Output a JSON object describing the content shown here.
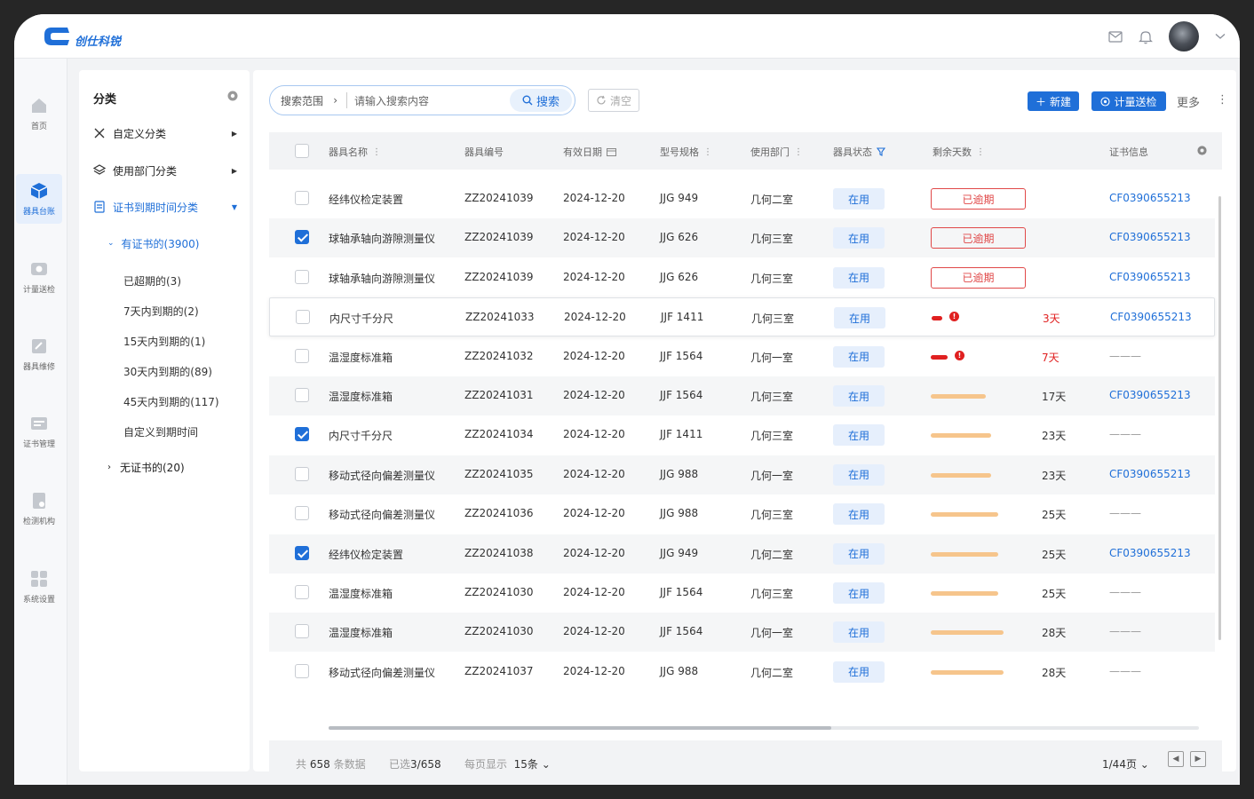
{
  "app": {
    "brand": "创仕科锐"
  },
  "nav": [
    {
      "label": "首页",
      "icon": "home-icon"
    },
    {
      "label": "器具台账",
      "icon": "cube-icon",
      "active": true
    },
    {
      "label": "计量送检",
      "icon": "meter-icon"
    },
    {
      "label": "器具维修",
      "icon": "repair-icon"
    },
    {
      "label": "证书管理",
      "icon": "certificate-icon"
    },
    {
      "label": "检测机构",
      "icon": "lab-icon"
    },
    {
      "label": "系统设置",
      "icon": "settings-grid-icon"
    }
  ],
  "category": {
    "title": "分类",
    "items": [
      {
        "label": "自定义分类"
      },
      {
        "label": "使用部门分类"
      },
      {
        "label": "证书到期时间分类"
      }
    ],
    "group_with_cert": "有证书的(3900)",
    "sub_items": [
      "已超期的(3)",
      "7天内到期的(2)",
      "15天内到期的(1)",
      "30天内到期的(89)",
      "45天内到期的(117)",
      "自定义到期时间"
    ],
    "group_no_cert": "无证书的(20)"
  },
  "toolbar": {
    "search_scope": "搜索范围",
    "search_placeholder": "请输入搜索内容",
    "search_label": "搜索",
    "clear_label": "清空",
    "new_label": "新建",
    "send_label": "计量送检",
    "more_label": "更多"
  },
  "columns": [
    "器具名称",
    "器具编号",
    "有效日期",
    "型号规格",
    "使用部门",
    "器具状态",
    "剩余天数",
    "证书信息"
  ],
  "rows": [
    {
      "checked": false,
      "name": "经纬仪检定装置",
      "code": "ZZ20241039",
      "date": "2024-12-20",
      "model": "JJG 949",
      "dept": "几何二室",
      "status": "在用",
      "remain_type": "overdue",
      "remain_label": "已逾期",
      "cert": "CF0390655213"
    },
    {
      "checked": true,
      "name": "球轴承轴向游隙测量仪",
      "code": "ZZ20241039",
      "date": "2024-12-20",
      "model": "JJG 626",
      "dept": "几何三室",
      "status": "在用",
      "remain_type": "overdue",
      "remain_label": "已逾期",
      "cert": "CF0390655213"
    },
    {
      "checked": false,
      "name": "球轴承轴向游隙测量仪",
      "code": "ZZ20241039",
      "date": "2024-12-20",
      "model": "JJG 626",
      "dept": "几何三室",
      "status": "在用",
      "remain_type": "overdue",
      "remain_label": "已逾期",
      "cert": "CF0390655213"
    },
    {
      "checked": false,
      "name": "内尺寸千分尺",
      "code": "ZZ20241033",
      "date": "2024-12-20",
      "model": "JJF 1411",
      "dept": "几何三室",
      "status": "在用",
      "remain_type": "warn",
      "remain_label": "3天",
      "remain_fraction": 0.1,
      "cert": "CF0390655213"
    },
    {
      "checked": false,
      "name": "温湿度标准箱",
      "code": "ZZ20241032",
      "date": "2024-12-20",
      "model": "JJF 1564",
      "dept": "几何一室",
      "status": "在用",
      "remain_type": "warn",
      "remain_label": "7天",
      "remain_fraction": 0.16,
      "cert": "———"
    },
    {
      "checked": false,
      "name": "温湿度标准箱",
      "code": "ZZ20241031",
      "date": "2024-12-20",
      "model": "JJF 1564",
      "dept": "几何三室",
      "status": "在用",
      "remain_type": "normal",
      "remain_label": "17天",
      "remain_fraction": 0.52,
      "cert": "CF0390655213"
    },
    {
      "checked": true,
      "name": "内尺寸千分尺",
      "code": "ZZ20241034",
      "date": "2024-12-20",
      "model": "JJF 1411",
      "dept": "几何三室",
      "status": "在用",
      "remain_type": "normal",
      "remain_label": "23天",
      "remain_fraction": 0.57,
      "cert": "———"
    },
    {
      "checked": false,
      "name": "移动式径向偏差测量仪",
      "code": "ZZ20241035",
      "date": "2024-12-20",
      "model": "JJG 988",
      "dept": "几何一室",
      "status": "在用",
      "remain_type": "normal",
      "remain_label": "23天",
      "remain_fraction": 0.57,
      "cert": "CF0390655213"
    },
    {
      "checked": false,
      "name": "移动式径向偏差测量仪",
      "code": "ZZ20241036",
      "date": "2024-12-20",
      "model": "JJG 988",
      "dept": "几何三室",
      "status": "在用",
      "remain_type": "normal",
      "remain_label": "25天",
      "remain_fraction": 0.63,
      "cert": "———"
    },
    {
      "checked": true,
      "name": "经纬仪检定装置",
      "code": "ZZ20241038",
      "date": "2024-12-20",
      "model": "JJG 949",
      "dept": "几何二室",
      "status": "在用",
      "remain_type": "normal",
      "remain_label": "25天",
      "remain_fraction": 0.63,
      "cert": "CF0390655213"
    },
    {
      "checked": false,
      "name": "温湿度标准箱",
      "code": "ZZ20241030",
      "date": "2024-12-20",
      "model": "JJF 1564",
      "dept": "几何三室",
      "status": "在用",
      "remain_type": "normal",
      "remain_label": "25天",
      "remain_fraction": 0.63,
      "cert": "———"
    },
    {
      "checked": false,
      "name": "温湿度标准箱",
      "code": "ZZ20241030",
      "date": "2024-12-20",
      "model": "JJF 1564",
      "dept": "几何一室",
      "status": "在用",
      "remain_type": "normal",
      "remain_label": "28天",
      "remain_fraction": 0.68,
      "cert": "———"
    },
    {
      "checked": false,
      "name": "移动式径向偏差测量仪",
      "code": "ZZ20241037",
      "date": "2024-12-20",
      "model": "JJG 988",
      "dept": "几何二室",
      "status": "在用",
      "remain_type": "normal",
      "remain_label": "28天",
      "remain_fraction": 0.68,
      "cert": "———"
    }
  ],
  "footer": {
    "total_prefix": "共",
    "total": "658",
    "total_suffix": "条数据",
    "selected_prefix": "已选",
    "selected": "3/658",
    "page_size_label": "每页显示",
    "page_size": "15条",
    "page": "1/44页"
  },
  "colors": {
    "accent": "#1f6fd8",
    "danger": "#e02020",
    "warning_bar": "#f6c58c"
  }
}
